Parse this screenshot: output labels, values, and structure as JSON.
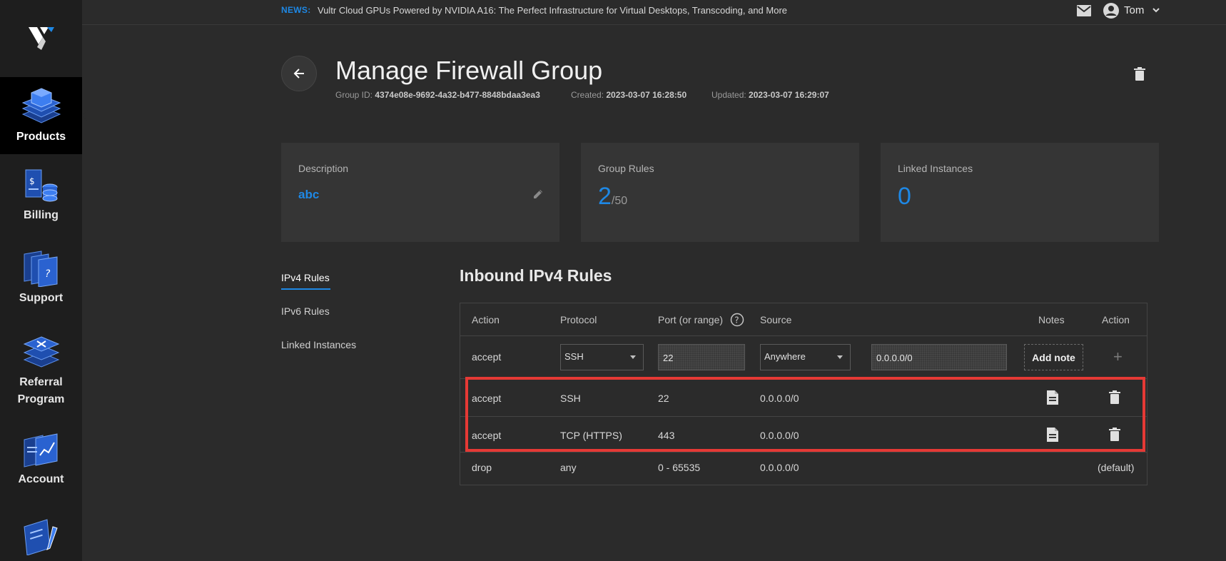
{
  "sidebar": {
    "items": [
      {
        "label": "Products",
        "icon": "products-stack-icon",
        "active": true
      },
      {
        "label": "Billing",
        "icon": "billing-icon"
      },
      {
        "label": "Support",
        "icon": "support-icon"
      },
      {
        "label": "Referral Program",
        "icon": "referral-icon"
      },
      {
        "label": "Account",
        "icon": "account-icon"
      },
      {
        "label": "",
        "icon": "docs-pen-icon"
      }
    ]
  },
  "topbar": {
    "news_label": "NEWS:",
    "news_text": "Vultr Cloud GPUs Powered by NVIDIA A16: The Perfect Infrastructure for Virtual Desktops, Transcoding, and More",
    "user_name": "Tom"
  },
  "header": {
    "title": "Manage Firewall Group",
    "group_id_label": "Group ID:",
    "group_id": "4374e08e-9692-4a32-b477-8848bdaa3ea3",
    "created_label": "Created:",
    "created": "2023-03-07 16:28:50",
    "updated_label": "Updated:",
    "updated": "2023-03-07 16:29:07"
  },
  "cards": {
    "description": {
      "label": "Description",
      "value": "abc"
    },
    "group_rules": {
      "label": "Group Rules",
      "value": "2",
      "max": "/50"
    },
    "linked_instances": {
      "label": "Linked Instances",
      "value": "0"
    }
  },
  "tabs": [
    {
      "label": "IPv4 Rules",
      "active": true
    },
    {
      "label": "IPv6 Rules"
    },
    {
      "label": "Linked Instances"
    }
  ],
  "rules": {
    "title": "Inbound IPv4 Rules",
    "headers": {
      "action": "Action",
      "protocol": "Protocol",
      "port": "Port (or range)",
      "source": "Source",
      "notes": "Notes",
      "action2": "Action"
    },
    "new_rule": {
      "action": "accept",
      "protocol": "SSH",
      "port": "22",
      "source": "Anywhere",
      "cidr": "0.0.0.0/0",
      "add_note_label": "Add note",
      "add_symbol": "+"
    },
    "rows": [
      {
        "action": "accept",
        "protocol": "SSH",
        "port": "22",
        "source": "0.0.0.0/0"
      },
      {
        "action": "accept",
        "protocol": "TCP (HTTPS)",
        "port": "443",
        "source": "0.0.0.0/0"
      }
    ],
    "default_row": {
      "action": "drop",
      "protocol": "any",
      "port": "0 - 65535",
      "source": "0.0.0.0/0",
      "note": "(default)"
    }
  },
  "colors": {
    "accent": "#1e88e5",
    "highlight": "#e53935",
    "background": "#2b2b2b",
    "sidebar": "#1e1e1e"
  }
}
